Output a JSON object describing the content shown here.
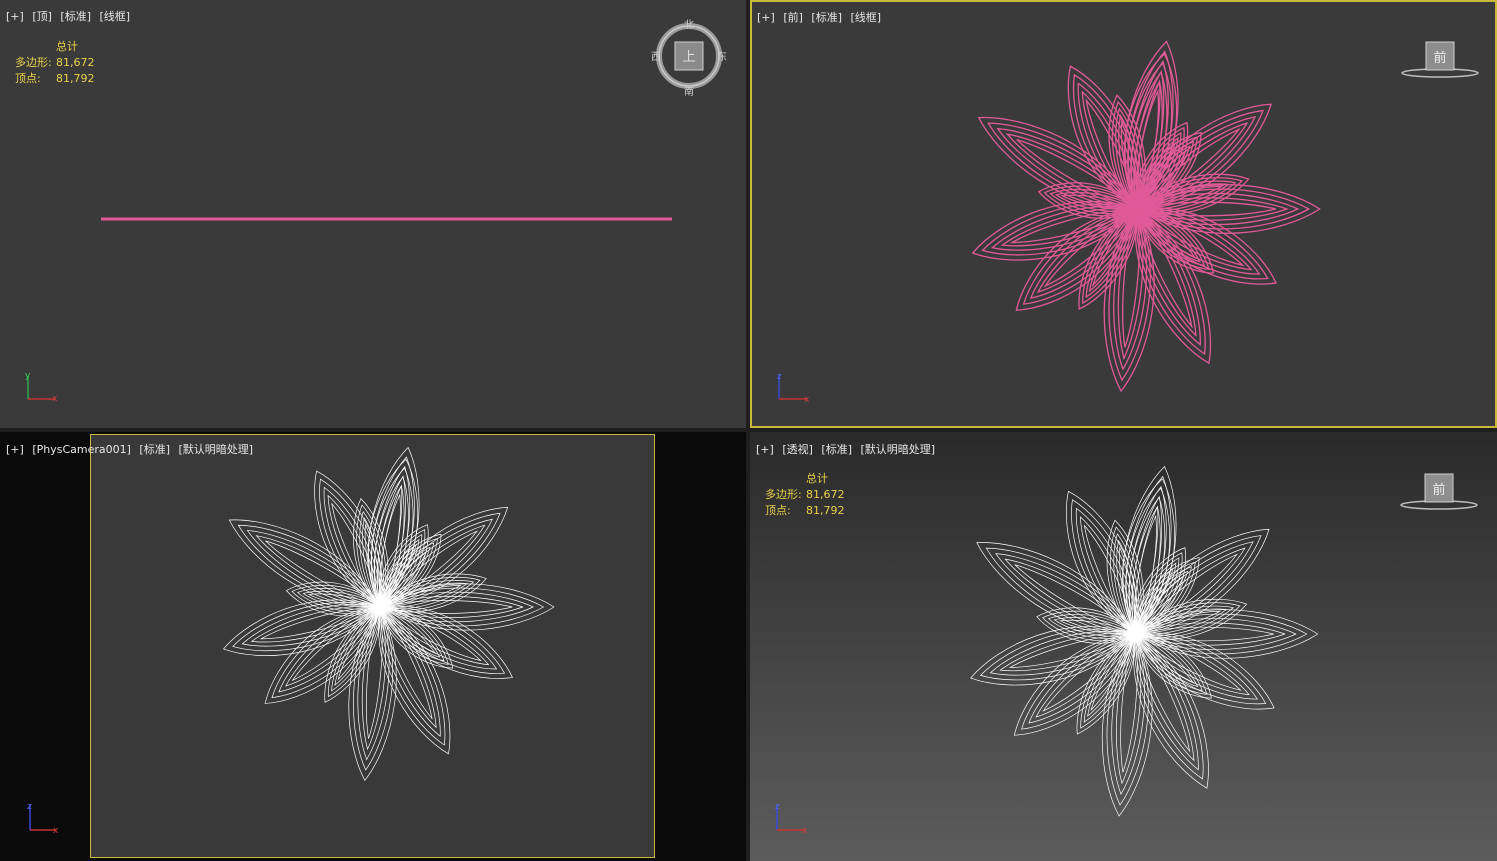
{
  "viewports": {
    "top": {
      "label": [
        "[+]",
        "[顶]",
        "[标准]",
        "[线框]"
      ],
      "stats": {
        "title": "总计",
        "polys_label": "多边形:",
        "polys": "81,672",
        "verts_label": "顶点:",
        "verts": "81,792"
      },
      "compass": {
        "n": "北",
        "s": "南",
        "e": "东",
        "w": "西",
        "center": "上"
      },
      "axis": {
        "v": "y",
        "h": "x"
      }
    },
    "front": {
      "label": [
        "[+]",
        "[前]",
        "[标准]",
        "[线框]"
      ],
      "cube": "前",
      "axis": {
        "v": "z",
        "h": "x"
      }
    },
    "camera": {
      "label": [
        "[+]",
        "[PhysCamera001]",
        "[标准]",
        "[默认明暗处理]"
      ],
      "axis": {
        "v": "z",
        "h": "x"
      }
    },
    "persp": {
      "label": [
        "[+]",
        "[透视]",
        "[标准]",
        "[默认明暗处理]"
      ],
      "stats": {
        "title": "总计",
        "polys_label": "多边形:",
        "polys": "81,672",
        "verts_label": "顶点:",
        "verts": "81,792"
      },
      "cube": "前",
      "axis": {
        "v": "z",
        "h": "x"
      }
    }
  },
  "colors": {
    "flower_front": "#e05a98",
    "flower_wire": "#ffffff",
    "active_border": "#c8b93c",
    "stat_text": "#e8d24a"
  }
}
